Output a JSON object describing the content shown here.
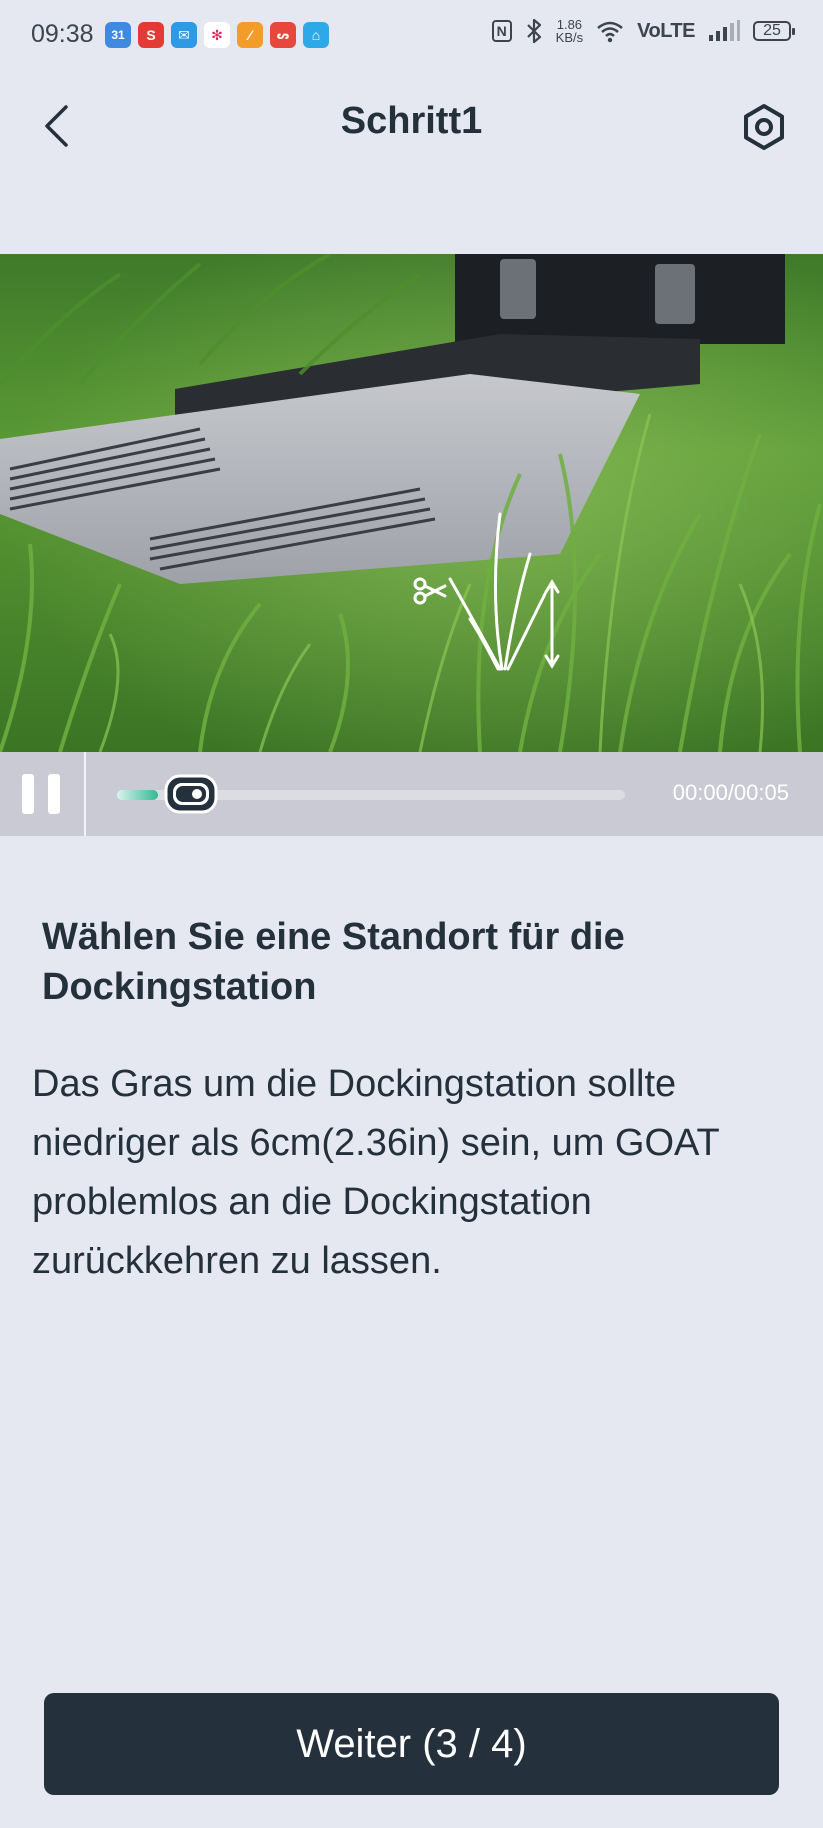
{
  "status_bar": {
    "time": "09:38",
    "speed_value": "1.86",
    "speed_unit": "KB/s",
    "network": "VoLTE",
    "battery": "25",
    "app_icons": [
      "calendar-icon",
      "s-app-icon",
      "mail-icon",
      "slack-icon",
      "fix-app-icon",
      "red-app-icon",
      "home-app-icon"
    ]
  },
  "header": {
    "title": "Schritt1"
  },
  "video": {
    "time_display": "00:00/00:05",
    "progress": 0.08
  },
  "content": {
    "heading": "Wählen Sie eine Standort für die Dockingstation",
    "description": "Das Gras um die Dockingstation sollte niedriger als 6cm(2.36in) sein, um GOAT problemlos an die Dockingstation zurückkehren zu lassen."
  },
  "footer": {
    "next_button_label": "Weiter (3 / 4)"
  },
  "colors": {
    "background": "#e5e8f0",
    "primary_dark": "#25303d",
    "accent": "#35b894"
  }
}
